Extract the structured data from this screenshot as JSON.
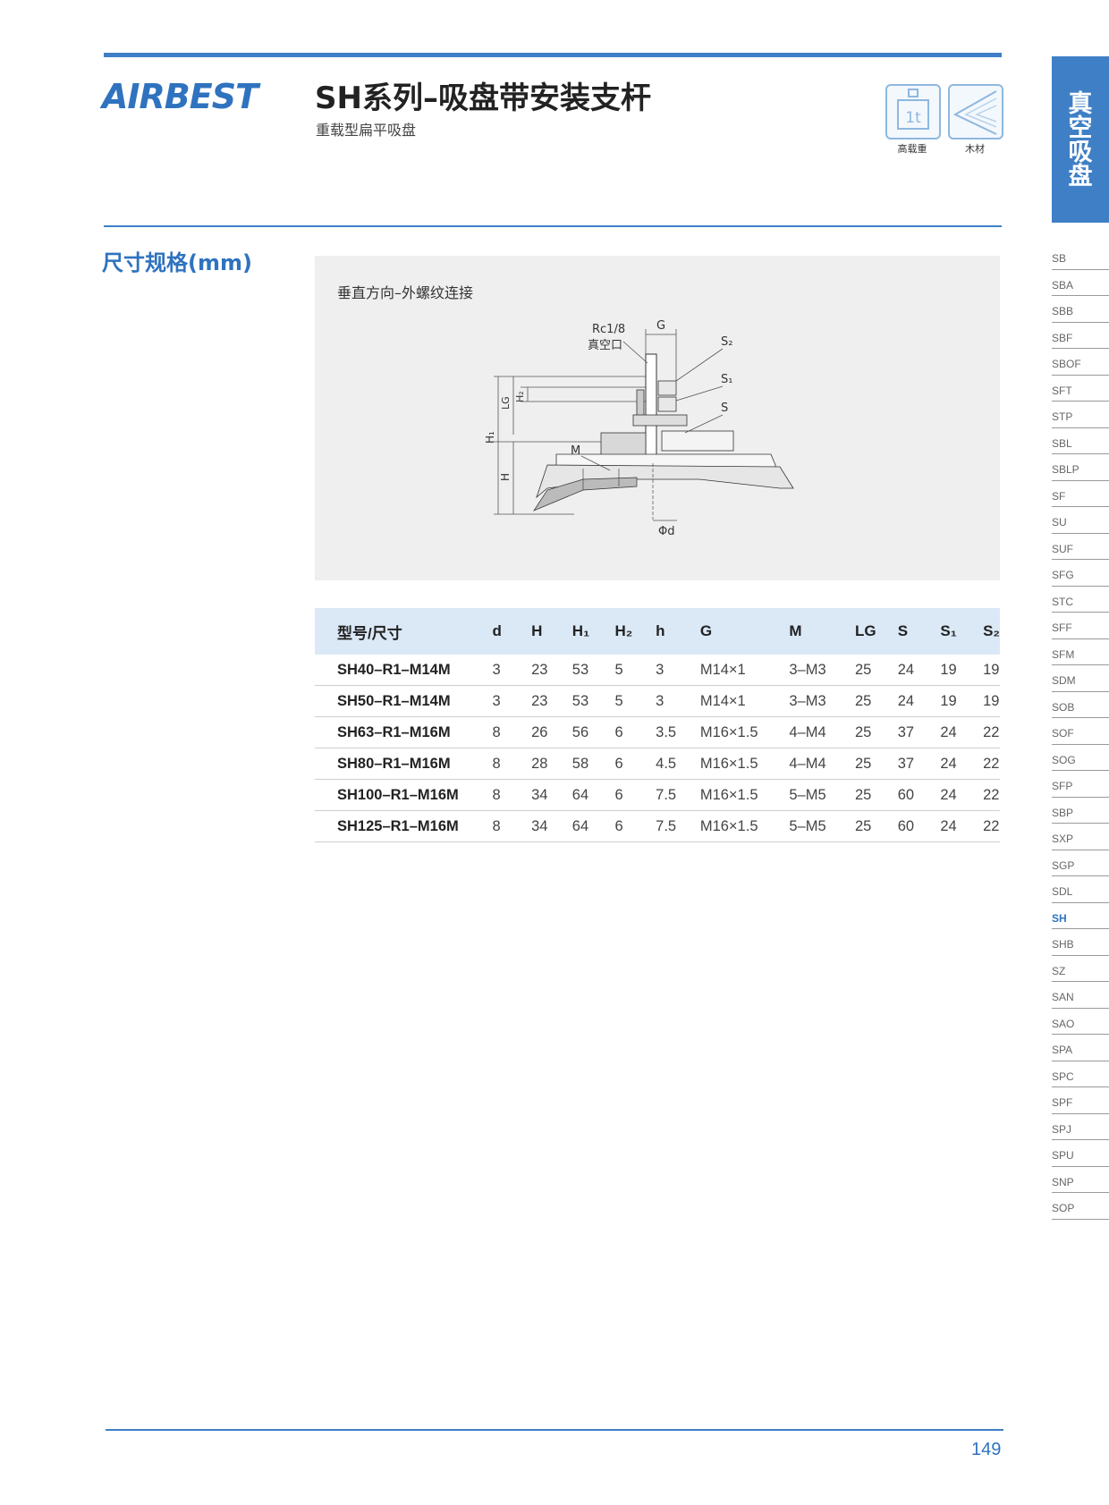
{
  "header": {
    "brand": "AIRBEST",
    "title": "SH系列–吸盘带安装支杆",
    "subtitle": "重载型扁平吸盘",
    "features": [
      {
        "icon": "heavy-load-icon",
        "glyph": "1t",
        "label": "高载重"
      },
      {
        "icon": "wood-icon",
        "label": "木材"
      }
    ],
    "category_tab": "真空吸盘"
  },
  "section": {
    "title": "尺寸规格(mm)"
  },
  "diagram": {
    "caption": "垂直方向–外螺纹连接",
    "labels": {
      "rc": "Rc1/8",
      "vacuum_port": "真空口",
      "g": "G",
      "s2": "S₂",
      "s1": "S₁",
      "s": "S",
      "m": "M",
      "lg": "LG",
      "h2": "H₂",
      "h1": "H₁",
      "h": "H",
      "phi_d": "Φd"
    }
  },
  "table": {
    "headers": [
      "型号/尺寸",
      "d",
      "H",
      "H₁",
      "H₂",
      "h",
      "G",
      "M",
      "LG",
      "S",
      "S₁",
      "S₂"
    ],
    "rows": [
      [
        "SH40–R1–M14M",
        "3",
        "23",
        "53",
        "5",
        "3",
        "M14×1",
        "3–M3",
        "25",
        "24",
        "19",
        "19"
      ],
      [
        "SH50–R1–M14M",
        "3",
        "23",
        "53",
        "5",
        "3",
        "M14×1",
        "3–M3",
        "25",
        "24",
        "19",
        "19"
      ],
      [
        "SH63–R1–M16M",
        "8",
        "26",
        "56",
        "6",
        "3.5",
        "M16×1.5",
        "4–M4",
        "25",
        "37",
        "24",
        "22"
      ],
      [
        "SH80–R1–M16M",
        "8",
        "28",
        "58",
        "6",
        "4.5",
        "M16×1.5",
        "4–M4",
        "25",
        "37",
        "24",
        "22"
      ],
      [
        "SH100–R1–M16M",
        "8",
        "34",
        "64",
        "6",
        "7.5",
        "M16×1.5",
        "5–M5",
        "25",
        "60",
        "24",
        "22"
      ],
      [
        "SH125–R1–M16M",
        "8",
        "34",
        "64",
        "6",
        "7.5",
        "M16×1.5",
        "5–M5",
        "25",
        "60",
        "24",
        "22"
      ]
    ]
  },
  "side_nav": {
    "items": [
      "SB",
      "SBA",
      "SBB",
      "SBF",
      "SBOF",
      "SFT",
      "STP",
      "SBL",
      "SBLP",
      "SF",
      "SU",
      "SUF",
      "SFG",
      "STC",
      "SFF",
      "SFM",
      "SDM",
      "SOB",
      "SOF",
      "SOG",
      "SFP",
      "SBP",
      "SXP",
      "SGP",
      "SDL",
      "SH",
      "SHB",
      "SZ",
      "SAN",
      "SAO",
      "SPA",
      "SPC",
      "SPF",
      "SPJ",
      "SPU",
      "SNP",
      "SOP"
    ],
    "active": "SH"
  },
  "footer": {
    "page_number": "149"
  },
  "colors": {
    "accent": "#3f7fc6",
    "header_row": "#dbe9f7",
    "diagram_bg": "#efefef"
  }
}
